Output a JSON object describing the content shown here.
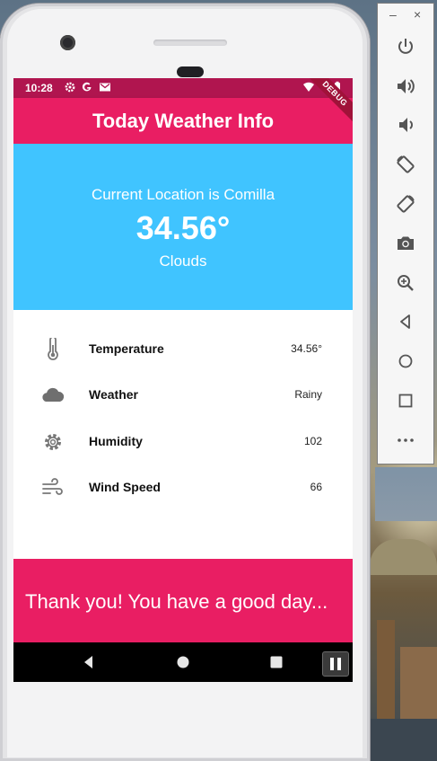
{
  "status_bar": {
    "time": "10:28"
  },
  "app_bar": {
    "title": "Today Weather Info",
    "debug_banner": "DEBUG"
  },
  "hero": {
    "location": "Current Location is Comilla",
    "temperature": "34.56°",
    "description": "Clouds"
  },
  "details": [
    {
      "icon": "thermometer-icon",
      "label": "Temperature",
      "value": "34.56°"
    },
    {
      "icon": "cloud-icon",
      "label": "Weather",
      "value": "Rainy"
    },
    {
      "icon": "gear-icon",
      "label": "Humidity",
      "value": "102"
    },
    {
      "icon": "wind-icon",
      "label": "Wind Speed",
      "value": "66"
    }
  ],
  "footer": {
    "message": "Thank you!  You have a good day..."
  },
  "emulator_toolbar": {
    "minimize": "–",
    "close": "×",
    "buttons": [
      "power-icon",
      "volume-up-icon",
      "volume-down-icon",
      "rotate-left-icon",
      "rotate-right-icon",
      "camera-icon",
      "zoom-icon",
      "back-icon",
      "home-icon",
      "overview-icon",
      "more-icon"
    ]
  },
  "colors": {
    "primary": "#e91e63",
    "status_bar": "#b0154f",
    "hero_bg": "#40c4ff",
    "nav_bar": "#000000"
  }
}
